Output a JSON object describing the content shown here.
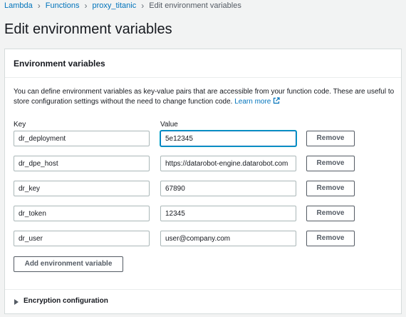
{
  "breadcrumb": {
    "items": [
      {
        "label": "Lambda"
      },
      {
        "label": "Functions"
      },
      {
        "label": "proxy_titanic"
      }
    ],
    "current": "Edit environment variables"
  },
  "page_title": "Edit environment variables",
  "panel": {
    "title": "Environment variables",
    "description": "You can define environment variables as key-value pairs that are accessible from your function code. These are useful to store configuration settings without the need to change function code.",
    "learn_more": "Learn more",
    "key_label": "Key",
    "value_label": "Value",
    "remove_label": "Remove",
    "variables": [
      {
        "key": "dr_deployment",
        "value": "5e12345"
      },
      {
        "key": "dr_dpe_host",
        "value": "https://datarobot-engine.datarobot.com"
      },
      {
        "key": "dr_key",
        "value": "67890"
      },
      {
        "key": "dr_token",
        "value": "12345"
      },
      {
        "key": "dr_user",
        "value": "user@company.com"
      }
    ],
    "add_label": "Add environment variable",
    "encryption_label": "Encryption configuration"
  },
  "colors": {
    "link": "#0073bb",
    "focus": "#00a1c9",
    "background": "#f2f3f3"
  }
}
